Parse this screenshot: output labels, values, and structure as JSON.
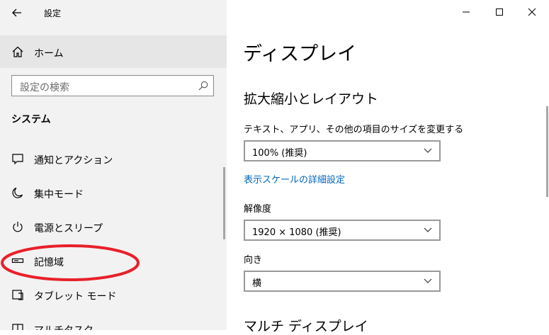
{
  "app": {
    "title": "設定"
  },
  "home": {
    "label": "ホーム"
  },
  "search": {
    "placeholder": "設定の検索"
  },
  "sidebar": {
    "section_title": "システム",
    "items": [
      {
        "label": "通知とアクション",
        "icon": "notification-icon"
      },
      {
        "label": "集中モード",
        "icon": "moon-icon"
      },
      {
        "label": "電源とスリープ",
        "icon": "power-icon"
      },
      {
        "label": "記憶域",
        "icon": "storage-icon"
      },
      {
        "label": "タブレット モード",
        "icon": "tablet-icon"
      },
      {
        "label": "マルチタスク",
        "icon": "multitask-icon"
      }
    ]
  },
  "annotation": {
    "color": "#e8202a"
  },
  "window_controls": {
    "minimize": "minimize-icon",
    "maximize": "maximize-icon",
    "close": "close-icon"
  },
  "main": {
    "title": "ディスプレイ",
    "scale_section": "拡大縮小とレイアウト",
    "text_size_label": "テキスト、アプリ、その他の項目のサイズを変更する",
    "scale_value": "100% (推奨)",
    "advanced_link": "表示スケールの詳細設定",
    "resolution_label": "解像度",
    "resolution_value": "1920 × 1080 (推奨)",
    "orientation_label": "向き",
    "orientation_value": "横",
    "multi_display_section": "マルチ ディスプレイ"
  },
  "colors": {
    "link": "#0067c0",
    "sidebar_bg": "#f2f2f2",
    "home_bg": "#e6e6e6"
  }
}
